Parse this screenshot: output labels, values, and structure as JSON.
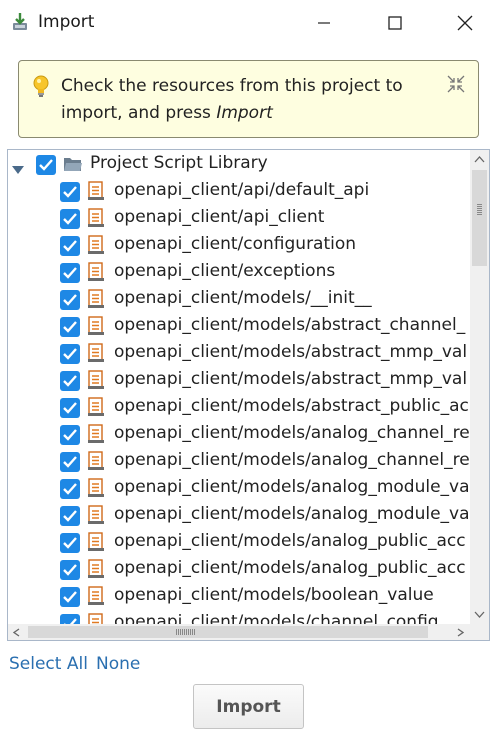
{
  "window": {
    "title": "Import",
    "icons": {
      "app": "import-arrow-icon",
      "minimize": "minimize-icon",
      "maximize": "maximize-icon",
      "close": "close-icon"
    }
  },
  "banner": {
    "text_prefix": "Check the resources from this project to import, and press ",
    "text_emphasis": "Import",
    "icons": {
      "hint": "lightbulb-icon",
      "dismiss": "collapse-icon"
    },
    "colors": {
      "background": "#fefee0",
      "border": "#8a8a70"
    }
  },
  "tree": {
    "root": {
      "label": "Project Script Library",
      "checked": true,
      "expanded": true,
      "icon": "folder-icon"
    },
    "items": [
      {
        "label": "openapi_client/api/default_api",
        "checked": true
      },
      {
        "label": "openapi_client/api_client",
        "checked": true
      },
      {
        "label": "openapi_client/configuration",
        "checked": true
      },
      {
        "label": "openapi_client/exceptions",
        "checked": true
      },
      {
        "label": "openapi_client/models/__init__",
        "checked": true
      },
      {
        "label": "openapi_client/models/abstract_channel_",
        "checked": true
      },
      {
        "label": "openapi_client/models/abstract_mmp_val",
        "checked": true
      },
      {
        "label": "openapi_client/models/abstract_mmp_val",
        "checked": true
      },
      {
        "label": "openapi_client/models/abstract_public_ac",
        "checked": true
      },
      {
        "label": "openapi_client/models/analog_channel_re",
        "checked": true
      },
      {
        "label": "openapi_client/models/analog_channel_re",
        "checked": true
      },
      {
        "label": "openapi_client/models/analog_module_va",
        "checked": true
      },
      {
        "label": "openapi_client/models/analog_module_va",
        "checked": true
      },
      {
        "label": "openapi_client/models/analog_public_acc",
        "checked": true
      },
      {
        "label": "openapi_client/models/analog_public_acc",
        "checked": true
      },
      {
        "label": "openapi_client/models/boolean_value",
        "checked": true
      },
      {
        "label": "openapi_client/models/channel_config",
        "checked": true
      }
    ],
    "item_icon": "script-file-icon",
    "colors": {
      "checkbox": "#1e88e5",
      "border": "#a9b7c9"
    }
  },
  "footer": {
    "select_all": "Select All",
    "none": "None",
    "import_button": "Import"
  }
}
